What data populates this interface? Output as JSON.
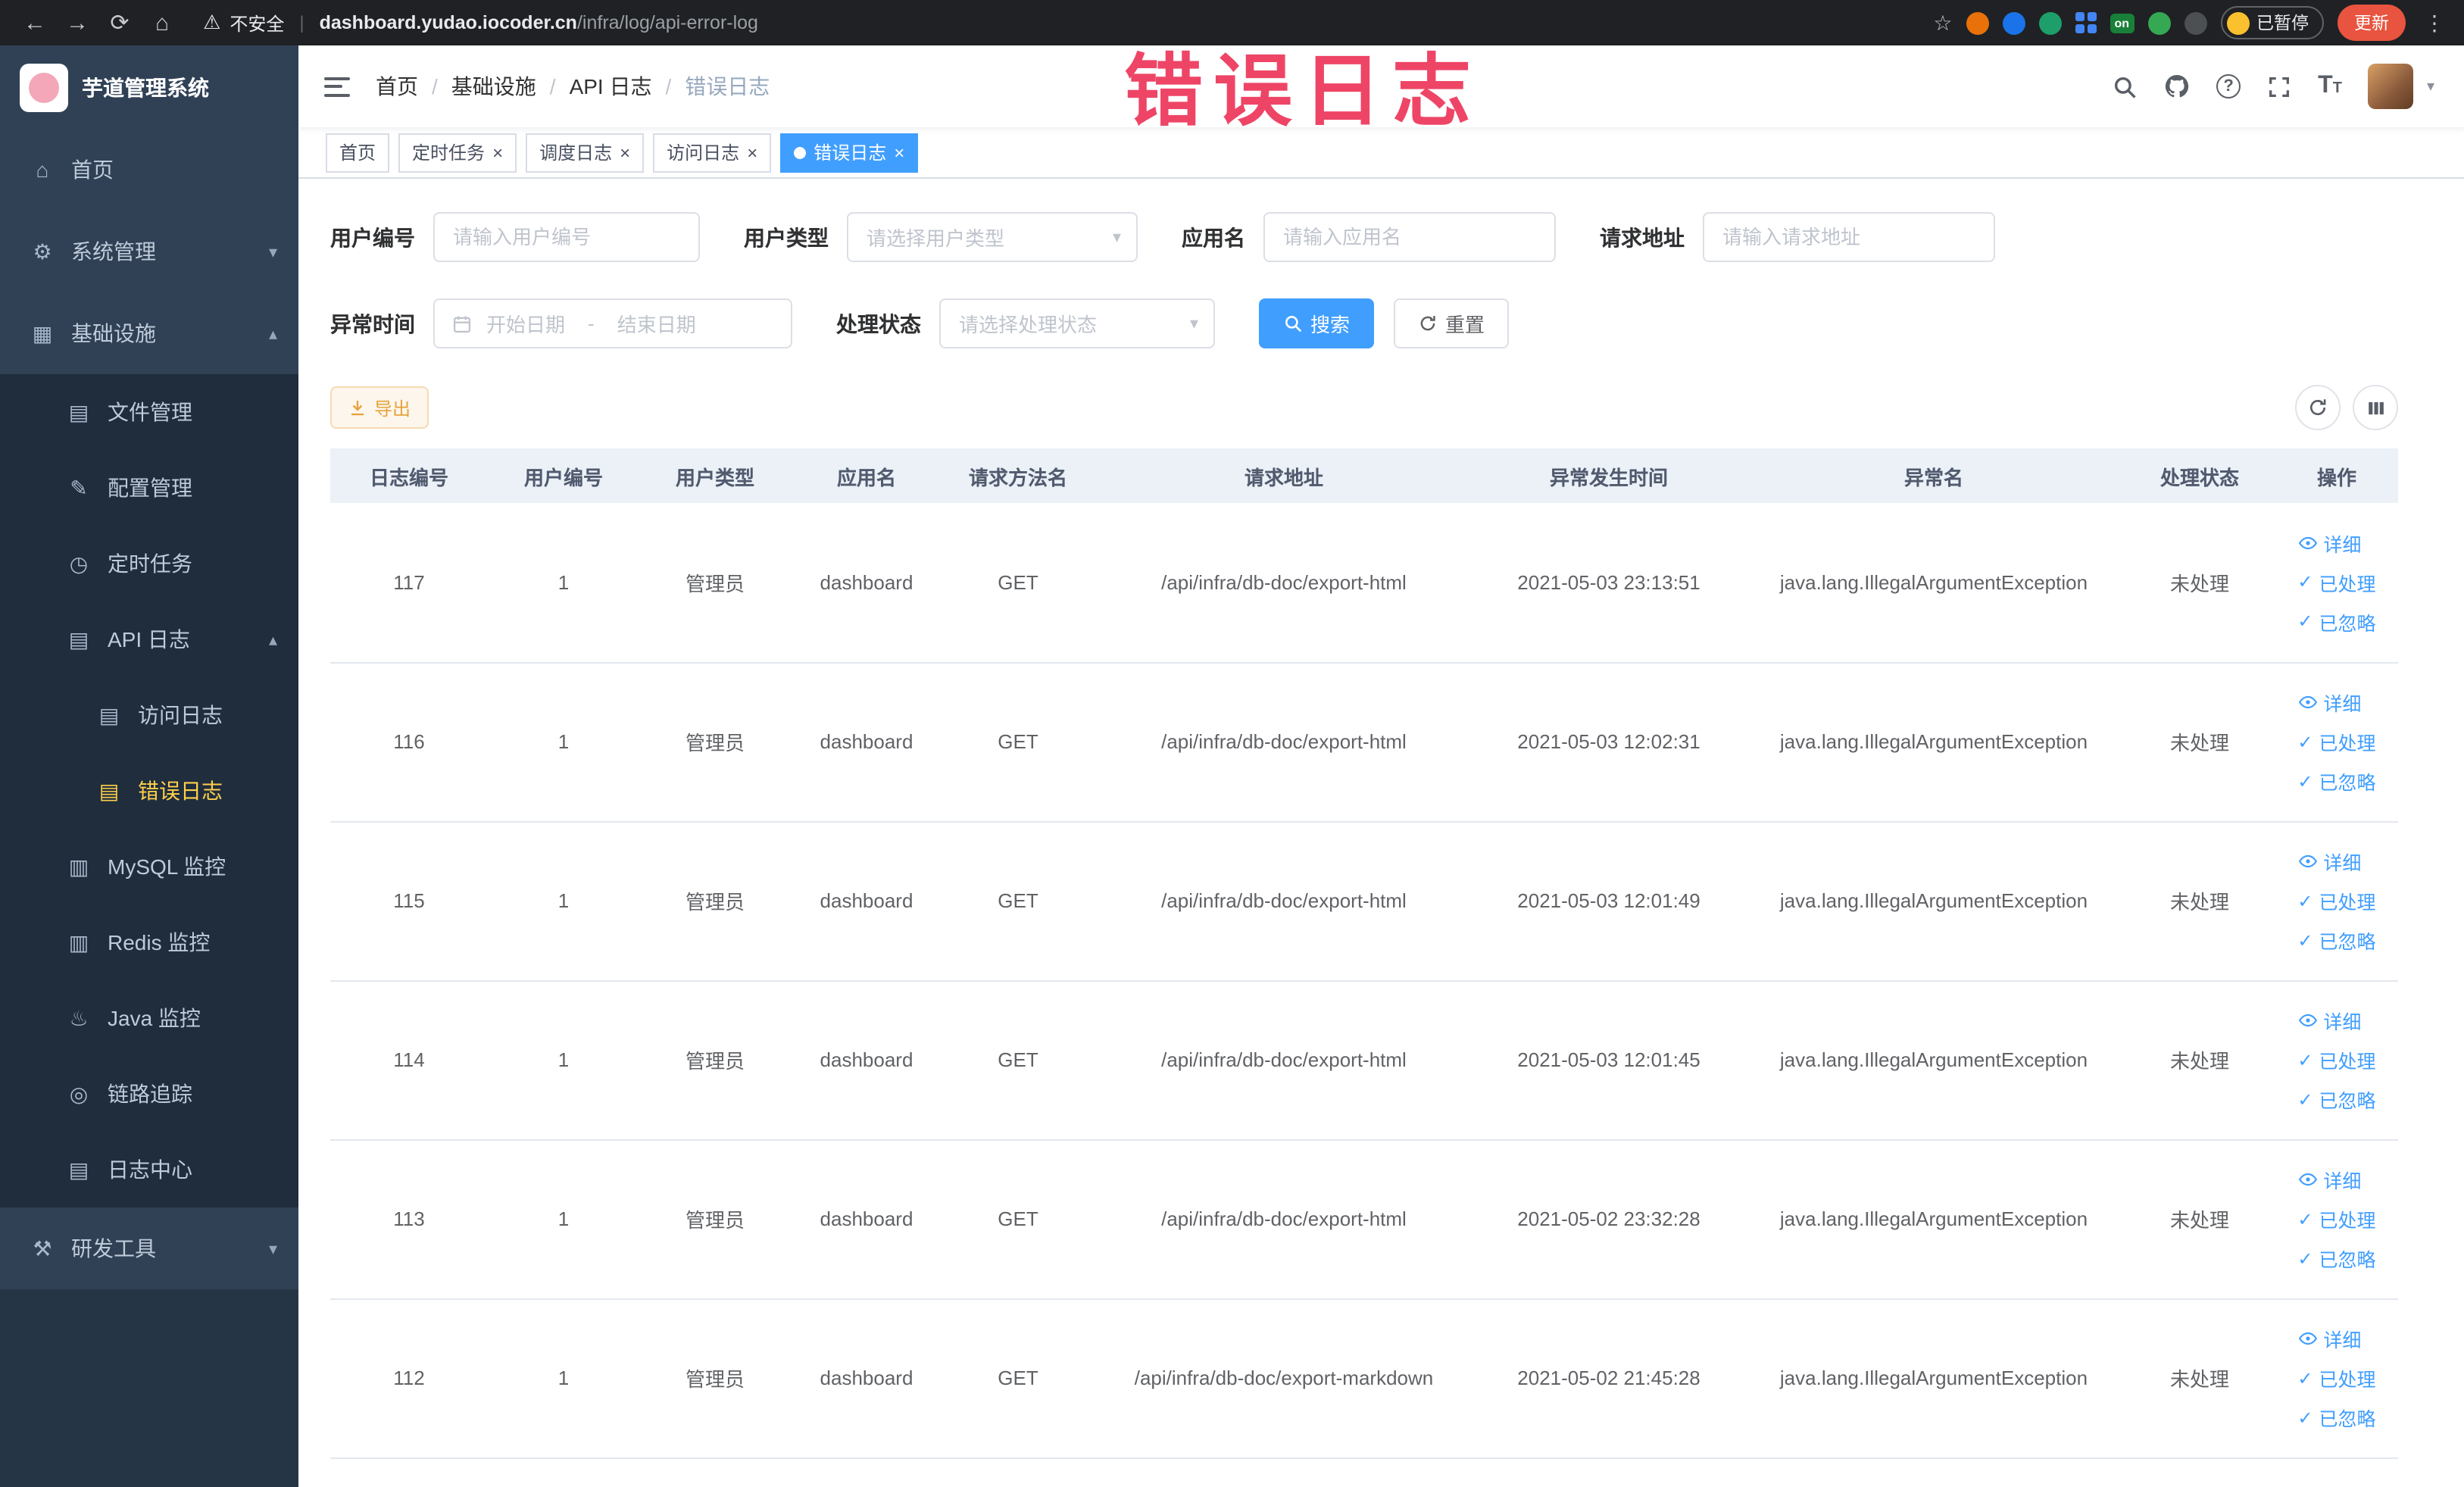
{
  "browser": {
    "security": "不安全",
    "url_domain": "dashboard.yudao.iocoder.cn",
    "url_path": "/infra/log/api-error-log",
    "on_badge": "on",
    "paused": "已暂停",
    "update": "更新"
  },
  "icons": {
    "back": "←",
    "forward": "→",
    "reload": "⟳",
    "home": "⌂",
    "warning": "⚠",
    "star": "☆",
    "more": "⋮",
    "pipe": "|",
    "caret_down": "▾",
    "caret_up": "▴",
    "close": "×",
    "dot": "●",
    "question": "?",
    "font_t": "T",
    "slash": "/",
    "check": "✓"
  },
  "sidebar": {
    "title": "芋道管理系统",
    "menu": [
      {
        "label": "首页",
        "glyph": "⌂"
      },
      {
        "label": "系统管理",
        "glyph": "⚙"
      },
      {
        "label": "基础设施",
        "glyph": "▦"
      },
      {
        "label": "文件管理",
        "glyph": "▤"
      },
      {
        "label": "配置管理",
        "glyph": "✎"
      },
      {
        "label": "定时任务",
        "glyph": "◷"
      },
      {
        "label": "API 日志",
        "glyph": "▤"
      },
      {
        "label": "访问日志",
        "glyph": "▤"
      },
      {
        "label": "错误日志",
        "glyph": "▤"
      },
      {
        "label": "MySQL 监控",
        "glyph": "▥"
      },
      {
        "label": "Redis 监控",
        "glyph": "▥"
      },
      {
        "label": "Java 监控",
        "glyph": "♨"
      },
      {
        "label": "链路追踪",
        "glyph": "◎"
      },
      {
        "label": "日志中心",
        "glyph": "▤"
      },
      {
        "label": "研发工具",
        "glyph": "⚒"
      }
    ]
  },
  "header": {
    "breadcrumb": [
      "首页",
      "基础设施",
      "API 日志",
      "错误日志"
    ],
    "watermark": "错误日志"
  },
  "tabs": {
    "items": [
      {
        "label": "首页"
      },
      {
        "label": "定时任务"
      },
      {
        "label": "调度日志"
      },
      {
        "label": "访问日志"
      },
      {
        "label": "错误日志"
      }
    ]
  },
  "filters": {
    "user_id_label": "用户编号",
    "user_id_placeholder": "请输入用户编号",
    "user_type_label": "用户类型",
    "user_type_placeholder": "请选择用户类型",
    "app_name_label": "应用名",
    "app_name_placeholder": "请输入应用名",
    "request_url_label": "请求地址",
    "request_url_placeholder": "请输入请求地址",
    "time_label": "异常时间",
    "start_placeholder": "开始日期",
    "range_sep": "-",
    "end_placeholder": "结束日期",
    "status_label": "处理状态",
    "status_placeholder": "请选择处理状态",
    "search": "搜索",
    "reset": "重置"
  },
  "toolbar": {
    "export": "导出"
  },
  "table": {
    "headers": [
      "日志编号",
      "用户编号",
      "用户类型",
      "应用名",
      "请求方法名",
      "请求地址",
      "异常发生时间",
      "异常名",
      "处理状态",
      "操作"
    ],
    "actions": [
      "详细",
      "已处理",
      "已忽略"
    ],
    "rows": [
      {
        "id": "117",
        "user_id": "1",
        "user_type": "管理员",
        "app": "dashboard",
        "method": "GET",
        "url": "/api/infra/db-doc/export-html",
        "time": "2021-05-03 23:13:51",
        "exception": "java.lang.IllegalArgumentException",
        "status": "未处理"
      },
      {
        "id": "116",
        "user_id": "1",
        "user_type": "管理员",
        "app": "dashboard",
        "method": "GET",
        "url": "/api/infra/db-doc/export-html",
        "time": "2021-05-03 12:02:31",
        "exception": "java.lang.IllegalArgumentException",
        "status": "未处理"
      },
      {
        "id": "115",
        "user_id": "1",
        "user_type": "管理员",
        "app": "dashboard",
        "method": "GET",
        "url": "/api/infra/db-doc/export-html",
        "time": "2021-05-03 12:01:49",
        "exception": "java.lang.IllegalArgumentException",
        "status": "未处理"
      },
      {
        "id": "114",
        "user_id": "1",
        "user_type": "管理员",
        "app": "dashboard",
        "method": "GET",
        "url": "/api/infra/db-doc/export-html",
        "time": "2021-05-03 12:01:45",
        "exception": "java.lang.IllegalArgumentException",
        "status": "未处理"
      },
      {
        "id": "113",
        "user_id": "1",
        "user_type": "管理员",
        "app": "dashboard",
        "method": "GET",
        "url": "/api/infra/db-doc/export-html",
        "time": "2021-05-02 23:32:28",
        "exception": "java.lang.IllegalArgumentException",
        "status": "未处理"
      },
      {
        "id": "112",
        "user_id": "1",
        "user_type": "管理员",
        "app": "dashboard",
        "method": "GET",
        "url": "/api/infra/db-doc/export-markdown",
        "time": "2021-05-02 21:45:28",
        "exception": "java.lang.IllegalArgumentException",
        "status": "未处理"
      }
    ]
  },
  "colors": {
    "accent": "#409eff",
    "warning": "#e6a23c",
    "sidebar_bg": "#304156",
    "sidebar_submenu_bg": "#1f2d3d",
    "sidebar_active": "#ffd04b",
    "watermark": "#ee4566",
    "table_header_bg": "#ebf1f7",
    "chrome_bg": "#202124",
    "update_button": "#e8543f"
  }
}
